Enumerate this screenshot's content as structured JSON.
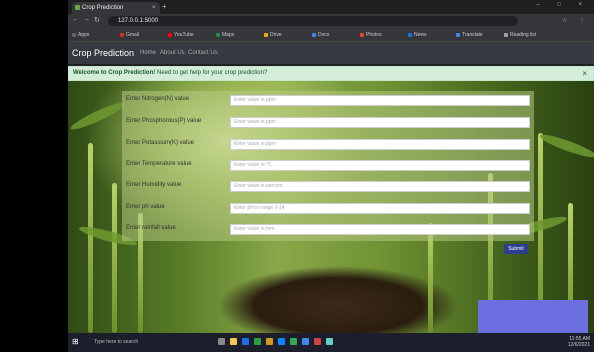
{
  "browser": {
    "tab_title": "Crop Prediction",
    "tab_close": "×",
    "new_tab": "+",
    "window_controls": "– □ ×",
    "nav": {
      "back": "←",
      "forward": "→",
      "reload": "↻"
    },
    "address": "127.0.0.1:5000",
    "toolbar_icons": "☆ ⋮",
    "bookmarks": [
      {
        "label": "Apps",
        "color": "#5f6368"
      },
      {
        "label": "Gmail",
        "color": "#d93025"
      },
      {
        "label": "YouTube",
        "color": "#ff0000"
      },
      {
        "label": "Maps",
        "color": "#1e8e3e"
      },
      {
        "label": "Drive",
        "color": "#f9ab00"
      },
      {
        "label": "Docs",
        "color": "#4285f4"
      },
      {
        "label": "Photos",
        "color": "#ea4335"
      },
      {
        "label": "News",
        "color": "#1a73e8"
      },
      {
        "label": "Translate",
        "color": "#4285f4"
      },
      {
        "label": "Reading list",
        "color": "#9aa0a6"
      }
    ]
  },
  "app": {
    "brand": "Crop Prediction",
    "nav_links": [
      "Home",
      "About Us",
      "Contact Us"
    ]
  },
  "alert": {
    "strong": "Welcome to Crop Prediction!",
    "text": " Need to get help for your crop prediction?",
    "close": "×"
  },
  "form": {
    "fields": [
      {
        "label": "Enter Nitrogen(N) value",
        "placeholder": "Enter value in ppm"
      },
      {
        "label": "Enter Phosphorous(P) value",
        "placeholder": "Enter value in ppm"
      },
      {
        "label": "Enter Potassium(K) value",
        "placeholder": "Enter value in ppm"
      },
      {
        "label": "Enter Temperature value",
        "placeholder": "Enter value in °C"
      },
      {
        "label": "Enter Humidity value",
        "placeholder": "Enter value in percent"
      },
      {
        "label": "Enter ph value",
        "placeholder": "Enter pH in range 0-14"
      },
      {
        "label": "Enter rainfall value",
        "placeholder": "Enter value in mm"
      }
    ],
    "submit": "Submit"
  },
  "taskbar": {
    "start": "⊞",
    "search": "Type here to search",
    "icon_colors": [
      "#888",
      "#f2c94c",
      "#1f6feb",
      "#2ea043",
      "#d29922",
      "#0a84ff",
      "#34a853",
      "#4285f4",
      "#c44",
      "#6cc"
    ],
    "time": "11:55 AM",
    "date": "12/6/2021"
  }
}
